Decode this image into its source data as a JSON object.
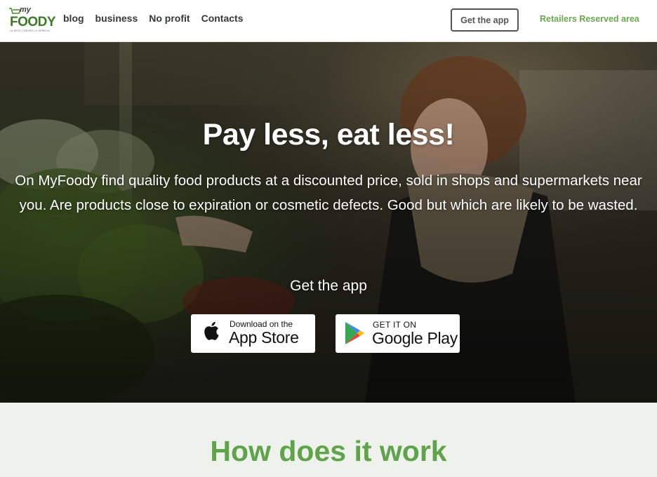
{
  "header": {
    "logo": {
      "my": "my",
      "word": "FOODY",
      "tagline": "LA RETE CONTRO LO SPRECO"
    },
    "nav": [
      "blog",
      "business",
      "No profit",
      "Contacts"
    ],
    "get_app_button": "Get the app",
    "retailers_link": "Retailers Reserved area"
  },
  "hero": {
    "title": "Pay less, eat less!",
    "text": "On MyFoody find quality food products at a discounted price, sold in shops and supermarkets near you. Are products close to expiration or cosmetic defects. Good but which are likely to be wasted.",
    "get_app": "Get the app",
    "app_store": {
      "small": "Download on the",
      "big": "App Store"
    },
    "google_play": {
      "small": "GET IT ON",
      "big": "Google Play"
    }
  },
  "how": {
    "title": "How does it work"
  },
  "colors": {
    "brand_green": "#5fa34a",
    "nav_text": "#333b33",
    "section_bg": "#eef1ec"
  }
}
